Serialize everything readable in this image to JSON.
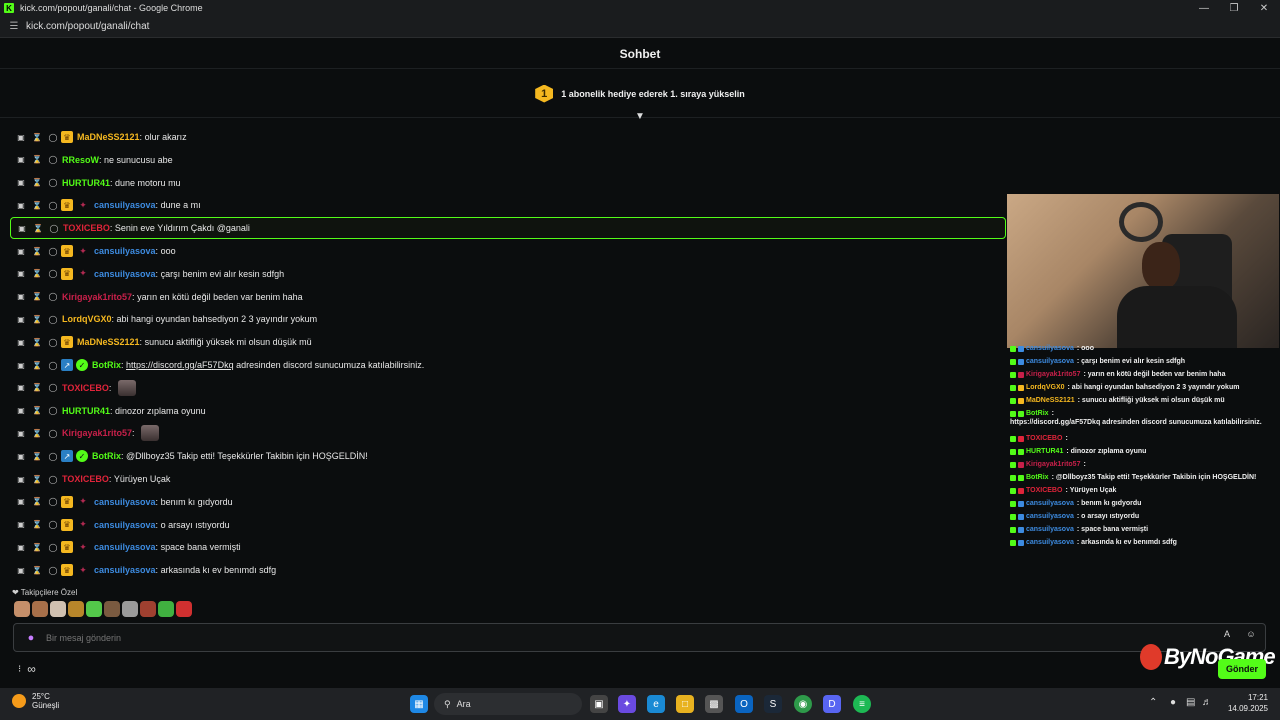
{
  "browser": {
    "title": "kick.com/popout/ganali/chat - Google Chrome",
    "url": "kick.com/popout/ganali/chat",
    "favicon": "K"
  },
  "chat": {
    "header": "Sohbet",
    "banner_rank": "1",
    "banner_text": "1 abonelik hediye ederek 1. sıraya yükselin",
    "messages": [
      {
        "user": "MaDNeSS2121",
        "text": "olur akarız",
        "color": "#f5b820"
      },
      {
        "user": "RResoW",
        "text": "ne sunucusu abe",
        "color": "#53fc18"
      },
      {
        "user": "HURTUR41",
        "text": "dune motoru mu",
        "color": "#53fc18"
      },
      {
        "user": "cansuilyasova",
        "text": "dune a mı",
        "color": "#3d8be0"
      },
      {
        "user": "TOXICEBO",
        "text": "Senin eve Yıldırım Çakdı @ganali",
        "color": "#e0243a"
      },
      {
        "user": "cansuilyasova",
        "text": "ooo",
        "color": "#3d8be0"
      },
      {
        "user": "cansuilyasova",
        "text": "çarşı benim evi alır kesin sdfgh",
        "color": "#3d8be0"
      },
      {
        "user": "Kirigayak1rito57",
        "text": "yarın en kötü değil beden var benim haha",
        "color": "#c8204a"
      },
      {
        "user": "LordqVGX0",
        "text": "abi hangi oyundan bahsediyon 2 3 yayındır yokum",
        "color": "#f5b820"
      },
      {
        "user": "MaDNeSS2121",
        "text": "sunucu aktifliği yüksek mi olsun düşük mü",
        "color": "#f5b820"
      },
      {
        "user": "BotRix",
        "link": "https://discord.gg/aF57Dkq",
        "text": "adresinden discord sunucumuza katılabilirsiniz.",
        "color": "#53fc18"
      },
      {
        "user": "TOXICEBO",
        "text": "",
        "color": "#e0243a"
      },
      {
        "user": "HURTUR41",
        "text": "dinozor zıplama oyunu",
        "color": "#53fc18"
      },
      {
        "user": "Kirigayak1rito57",
        "text": "",
        "color": "#c8204a"
      },
      {
        "user": "BotRix",
        "text": "@Dllboyz35 Takip etti! Teşekkürler Takibin için HOŞGELDİN!",
        "color": "#53fc18"
      },
      {
        "user": "TOXICEBO",
        "text": "Yürüyen Uçak",
        "color": "#e0243a"
      },
      {
        "user": "cansuilyasova",
        "text": "benım kı gıdyordu",
        "color": "#3d8be0"
      },
      {
        "user": "cansuilyasova",
        "text": "o arsayı ıstıyordu",
        "color": "#3d8be0"
      },
      {
        "user": "cansuilyasova",
        "text": "space bana vermişti",
        "color": "#3d8be0"
      },
      {
        "user": "cansuilyasova",
        "text": "arkasında kı ev benımdı sdfg",
        "color": "#3d8be0"
      }
    ],
    "followers_label": "Takipçilere Özel",
    "input_placeholder": "Bir mesaj gönderin",
    "send_label": "Gönder"
  },
  "overlay": {
    "messages": [
      {
        "user": "cansuilyasova",
        "text": "ooo",
        "color": "#3d8be0"
      },
      {
        "user": "cansuilyasova",
        "text": "çarşı benim evi alır kesin sdfgh",
        "color": "#3d8be0"
      },
      {
        "user": "Kirigayak1rito57",
        "text": "yarın en kötü değil beden var benim haha",
        "color": "#c8204a"
      },
      {
        "user": "LordqVGX0",
        "text": "abi hangi oyundan bahsediyon 2 3 yayındır yokum",
        "color": "#f5b820"
      },
      {
        "user": "MaDNeSS2121",
        "text": "sunucu aktifliği yüksek mi olsun düşük mü",
        "color": "#f5b820"
      },
      {
        "user": "BotRix",
        "text": "https://discord.gg/aF57Dkq adresinden discord sunucumuza katılabilirsiniz.",
        "color": "#53fc18"
      },
      {
        "user": "TOXICEBO",
        "text": "",
        "color": "#e0243a"
      },
      {
        "user": "HURTUR41",
        "text": "dinozor zıplama oyunu",
        "color": "#53fc18"
      },
      {
        "user": "Kirigayak1rito57",
        "text": "",
        "color": "#c8204a"
      },
      {
        "user": "BotRix",
        "text": "@Dllboyz35 Takip etti! Teşekkürler Takibin için HOŞGELDİN!",
        "color": "#53fc18"
      },
      {
        "user": "TOXICEBO",
        "text": "Yürüyen Uçak",
        "color": "#e0243a"
      },
      {
        "user": "cansuilyasova",
        "text": "benım kı gıdyordu",
        "color": "#3d8be0"
      },
      {
        "user": "cansuilyasova",
        "text": "o arsayı ıstıyordu",
        "color": "#3d8be0"
      },
      {
        "user": "cansuilyasova",
        "text": "space bana vermişti",
        "color": "#3d8be0"
      },
      {
        "user": "cansuilyasova",
        "text": "arkasında kı ev benımdı sdfg",
        "color": "#3d8be0"
      }
    ]
  },
  "watermark": "ByNoGame",
  "taskbar": {
    "weather_temp": "25°C",
    "weather_desc": "Güneşli",
    "search_label": "Ara",
    "time": "17:21",
    "date": "14.09.2025"
  },
  "colors": {
    "accent": "#53fc18",
    "background": "#0b0d0e"
  }
}
